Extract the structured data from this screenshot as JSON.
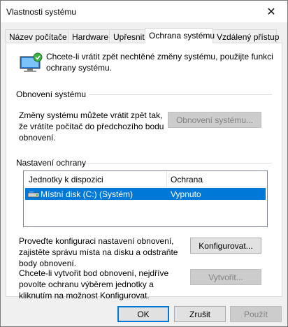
{
  "window": {
    "title": "Vlastnosti systému"
  },
  "tabs": [
    {
      "label": "Název počítače"
    },
    {
      "label": "Hardware"
    },
    {
      "label": "Upřesnit"
    },
    {
      "label": "Ochrana systému"
    },
    {
      "label": "Vzdálený přístup"
    }
  ],
  "intro": {
    "text": "Chcete-li vrátit zpět nechtěné změny systému, použijte funkci ochrany systému."
  },
  "restore": {
    "group_label": "Obnovení systému",
    "description": "Změny systému můžete vrátit zpět tak, že vrátíte počítač do předchozího bodu obnovení.",
    "button": "Obnovení systému..."
  },
  "protection": {
    "group_label": "Nastavení ochrany",
    "columns": [
      "Jednotky k dispozici",
      "Ochrana"
    ],
    "rows": [
      {
        "drive": "Místní disk (C:) (Systém)",
        "status": "Vypnuto"
      }
    ],
    "configure_description": "Proveďte konfiguraci nastavení obnovení, zajistěte správu místa na disku a odstraňte body obnovení.",
    "configure_button": "Konfigurovat...",
    "create_description": "Chcete-li vytvořit bod obnovení, nejdříve povolte ochranu výběrem jednotky a kliknutím na možnost Konfigurovat.",
    "create_button": "Vytvořit..."
  },
  "footer": {
    "ok": "OK",
    "cancel": "Zrušit",
    "apply": "Použít"
  },
  "colors": {
    "selection": "#0078d7",
    "default_border": "#0078d7",
    "disabled_text": "#838383"
  }
}
